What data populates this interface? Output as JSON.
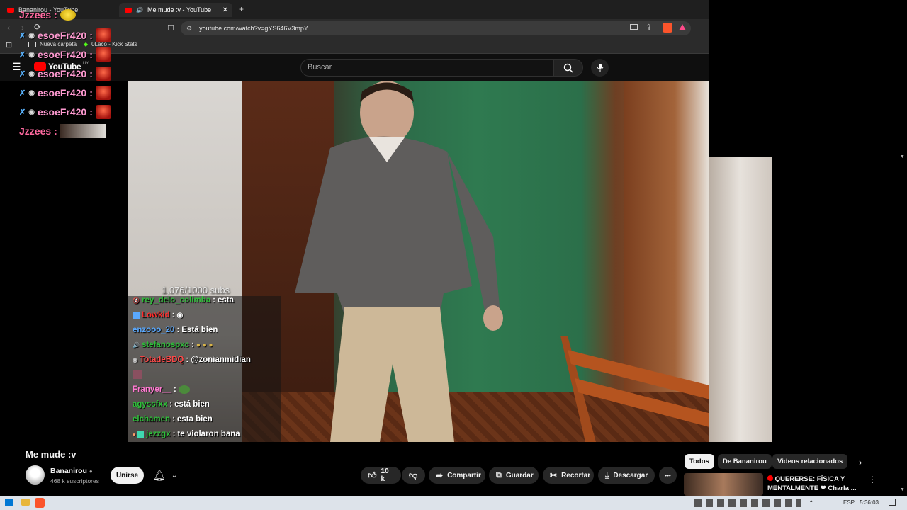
{
  "browser": {
    "tabs": [
      {
        "label": "Bananirou - YouTube",
        "active": false
      },
      {
        "label": "Me mude :v - YouTube",
        "active": true
      }
    ],
    "new_tab_symbol": "+",
    "url": "youtube.com/watch?v=gYS646V3mpY",
    "bookmarks": [
      {
        "label": "Nueva carpeta",
        "icon": "folder-icon"
      },
      {
        "label": "0Laco - Kick Stats",
        "icon": "kick-icon"
      }
    ]
  },
  "youtube": {
    "logo_text": "YouTube",
    "region": "UY",
    "search_placeholder": "Buscar"
  },
  "left_chat": [
    {
      "user": "Jzzees",
      "colon": ":",
      "kind": "top"
    },
    {
      "user": "esoeFr420",
      "colon": ":"
    },
    {
      "user": "esoeFr420",
      "colon": ":"
    },
    {
      "user": "esoeFr420",
      "colon": ":"
    },
    {
      "user": "esoeFr420",
      "colon": ":"
    },
    {
      "user": "esoeFr420",
      "colon": ":"
    },
    {
      "user": "Jzzees",
      "colon": ":"
    }
  ],
  "overlay": {
    "subs_counter": "1,076/1000 subs",
    "chat": [
      {
        "user": "rey_delo_colimba",
        "sep": ":",
        "text": "esta",
        "color": "#2fbf3a"
      },
      {
        "user": "Lowkid",
        "sep": ":",
        "text": "",
        "color": "#ff2e2e"
      },
      {
        "user": "enzooo_20",
        "sep": ":",
        "text": "Está bien",
        "color": "#5aa9ff"
      },
      {
        "user": "stefanospxc",
        "sep": ":",
        "text": "",
        "color": "#2fbf3a"
      },
      {
        "user": "TotadeBDQ",
        "sep": ":",
        "text": "@zonianmidian",
        "color": "#ff4a4a"
      },
      {
        "user": "",
        "sep": "",
        "text": "",
        "color": "#ffffff"
      },
      {
        "user": "Franyer__",
        "sep": ":",
        "text": "",
        "color": "#ff7ad1"
      },
      {
        "user": "agyssfxx",
        "sep": ":",
        "text": "está bien",
        "color": "#2fbf3a"
      },
      {
        "user": "elchamen",
        "sep": ":",
        "text": "esta bien",
        "color": "#2fbf3a"
      },
      {
        "user": "jezzgx",
        "sep": ":",
        "text": "te violaron bana",
        "color": "#2fbf3a"
      }
    ]
  },
  "video": {
    "title": "Me mude :v",
    "channel": "Bananirou",
    "subscribers": "468 k suscriptores",
    "join_label": "Unirse",
    "likes": "10 k",
    "share_label": "Compartir",
    "save_label": "Guardar",
    "clip_label": "Recortar",
    "download_label": "Descargar",
    "more_label": "•••"
  },
  "sidebar": {
    "chips": [
      {
        "label": "Todos",
        "active": true
      },
      {
        "label": "De Bananirou",
        "active": false
      },
      {
        "label": "Videos relacionados",
        "active": false
      }
    ],
    "recommendation": {
      "title": "QUERERSE: FÍSICA Y MENTALMENTE ❤ Charla ..."
    }
  },
  "taskbar": {
    "lang": "ESP",
    "time": "5:36:03"
  },
  "colors": {
    "yt_red": "#ff0000",
    "bg": "#0f0f0f",
    "chat_pink": "#ff9ad1"
  }
}
